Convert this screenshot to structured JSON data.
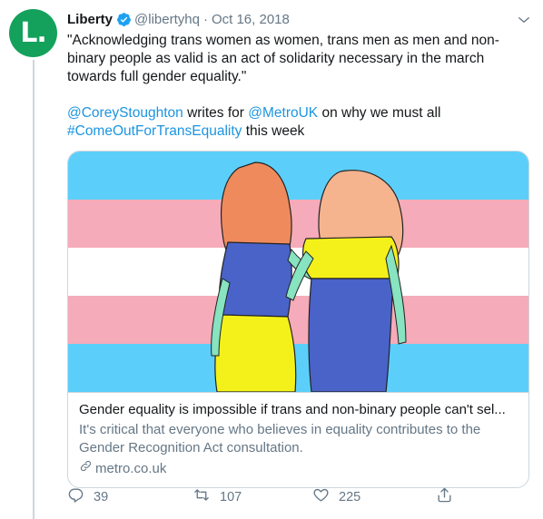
{
  "account": {
    "name": "Liberty",
    "handle": "@libertyhq",
    "separator": "·",
    "date": "Oct 16, 2018",
    "avatar_letter": "L."
  },
  "tweet": {
    "quote": "\"Acknowledging trans women as women, trans men as men and non-binary people as valid is an act of solidarity necessary in the march towards full gender equality.\"",
    "mention_author": "@CoreyStoughton",
    "text_writes_for": " writes for ",
    "mention_outlet": "@MetroUK",
    "text_why": " on why we must all",
    "hashtag": "#ComeOutForTransEquality",
    "text_this_week": " this week"
  },
  "card": {
    "title": "Gender equality is impossible if trans and non-binary people can't sel...",
    "description": "It's critical that everyone who believes in equality contributes to the Gender Recognition Act consultation.",
    "domain": "metro.co.uk"
  },
  "actions": {
    "reply_count": "39",
    "retweet_count": "107",
    "like_count": "225"
  },
  "colors": {
    "accent": "#1b95e0",
    "avatar_bg": "#14a15b",
    "trans_blue": "#5bcffa",
    "trans_pink": "#f5abb9",
    "trans_white": "#ffffff"
  },
  "icons": {
    "verified": "verified-badge-icon",
    "caret": "chevron-down-icon",
    "link": "link-icon",
    "reply": "reply-icon",
    "retweet": "retweet-icon",
    "like": "heart-icon",
    "share": "share-icon"
  }
}
